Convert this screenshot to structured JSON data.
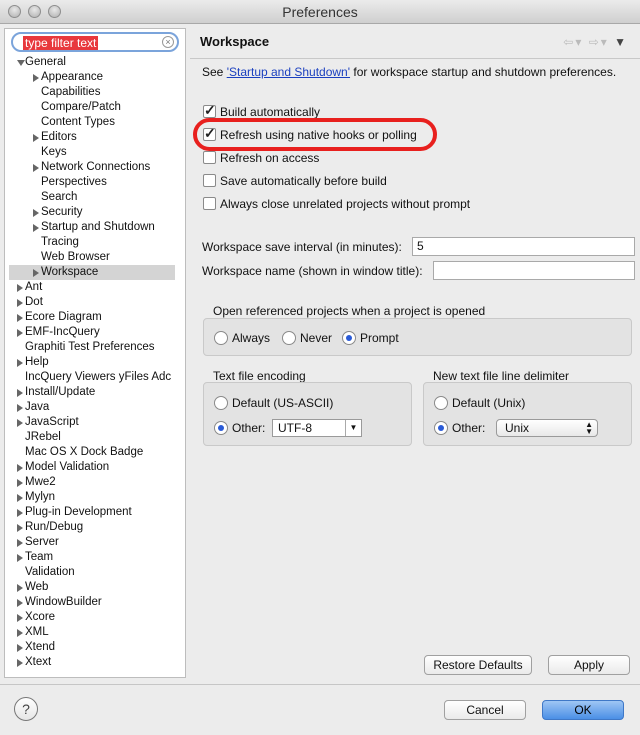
{
  "window": {
    "title": "Preferences"
  },
  "filter": {
    "value": "type filter text"
  },
  "tree": [
    {
      "label": "General",
      "indent": 1,
      "arrow": "down"
    },
    {
      "label": "Appearance",
      "indent": 2,
      "arrow": "right"
    },
    {
      "label": "Capabilities",
      "indent": 2,
      "arrow": ""
    },
    {
      "label": "Compare/Patch",
      "indent": 2,
      "arrow": ""
    },
    {
      "label": "Content Types",
      "indent": 2,
      "arrow": ""
    },
    {
      "label": "Editors",
      "indent": 2,
      "arrow": "right"
    },
    {
      "label": "Keys",
      "indent": 2,
      "arrow": ""
    },
    {
      "label": "Network Connections",
      "indent": 2,
      "arrow": "right"
    },
    {
      "label": "Perspectives",
      "indent": 2,
      "arrow": ""
    },
    {
      "label": "Search",
      "indent": 2,
      "arrow": ""
    },
    {
      "label": "Security",
      "indent": 2,
      "arrow": "right"
    },
    {
      "label": "Startup and Shutdown",
      "indent": 2,
      "arrow": "right"
    },
    {
      "label": "Tracing",
      "indent": 2,
      "arrow": ""
    },
    {
      "label": "Web Browser",
      "indent": 2,
      "arrow": ""
    },
    {
      "label": "Workspace",
      "indent": 2,
      "arrow": "right",
      "selected": true
    },
    {
      "label": "Ant",
      "indent": 1,
      "arrow": "right"
    },
    {
      "label": "Dot",
      "indent": 1,
      "arrow": "right"
    },
    {
      "label": "Ecore Diagram",
      "indent": 1,
      "arrow": "right"
    },
    {
      "label": "EMF-IncQuery",
      "indent": 1,
      "arrow": "right"
    },
    {
      "label": "Graphiti Test Preferences",
      "indent": 1,
      "arrow": ""
    },
    {
      "label": "Help",
      "indent": 1,
      "arrow": "right"
    },
    {
      "label": "IncQuery Viewers yFiles Adc",
      "indent": 1,
      "arrow": ""
    },
    {
      "label": "Install/Update",
      "indent": 1,
      "arrow": "right"
    },
    {
      "label": "Java",
      "indent": 1,
      "arrow": "right"
    },
    {
      "label": "JavaScript",
      "indent": 1,
      "arrow": "right"
    },
    {
      "label": "JRebel",
      "indent": 1,
      "arrow": ""
    },
    {
      "label": "Mac OS X Dock Badge",
      "indent": 1,
      "arrow": ""
    },
    {
      "label": "Model Validation",
      "indent": 1,
      "arrow": "right"
    },
    {
      "label": "Mwe2",
      "indent": 1,
      "arrow": "right"
    },
    {
      "label": "Mylyn",
      "indent": 1,
      "arrow": "right"
    },
    {
      "label": "Plug-in Development",
      "indent": 1,
      "arrow": "right"
    },
    {
      "label": "Run/Debug",
      "indent": 1,
      "arrow": "right"
    },
    {
      "label": "Server",
      "indent": 1,
      "arrow": "right"
    },
    {
      "label": "Team",
      "indent": 1,
      "arrow": "right"
    },
    {
      "label": "Validation",
      "indent": 1,
      "arrow": ""
    },
    {
      "label": "Web",
      "indent": 1,
      "arrow": "right"
    },
    {
      "label": "WindowBuilder",
      "indent": 1,
      "arrow": "right"
    },
    {
      "label": "Xcore",
      "indent": 1,
      "arrow": "right"
    },
    {
      "label": "XML",
      "indent": 1,
      "arrow": "right"
    },
    {
      "label": "Xtend",
      "indent": 1,
      "arrow": "right"
    },
    {
      "label": "Xtext",
      "indent": 1,
      "arrow": "right"
    }
  ],
  "page": {
    "title": "Workspace",
    "see_prefix": "See ",
    "see_link": "'Startup and Shutdown'",
    "see_suffix": " for workspace startup and shutdown preferences.",
    "checkboxes": [
      {
        "label": "Build automatically",
        "checked": true
      },
      {
        "label": "Refresh using native hooks or polling",
        "checked": true
      },
      {
        "label": "Refresh on access",
        "checked": false
      },
      {
        "label": "Save automatically before build",
        "checked": false
      },
      {
        "label": "Always close unrelated projects without prompt",
        "checked": false
      }
    ],
    "save_interval_label": "Workspace save interval (in minutes):",
    "save_interval_value": "5",
    "workspace_name_label": "Workspace name (shown in window title):",
    "workspace_name_value": "",
    "open_ref_group": {
      "title": "Open referenced projects when a project is opened",
      "options": [
        "Always",
        "Never",
        "Prompt"
      ],
      "selected": "Prompt"
    },
    "encoding_group": {
      "title": "Text file encoding",
      "default_label": "Default (US-ASCII)",
      "other_label": "Other:",
      "other_value": "UTF-8"
    },
    "delimiter_group": {
      "title": "New text file line delimiter",
      "default_label": "Default (Unix)",
      "other_label": "Other:",
      "other_value": "Unix"
    },
    "restore_defaults": "Restore Defaults",
    "apply": "Apply"
  },
  "footer": {
    "help": "?",
    "cancel": "Cancel",
    "ok": "OK"
  }
}
